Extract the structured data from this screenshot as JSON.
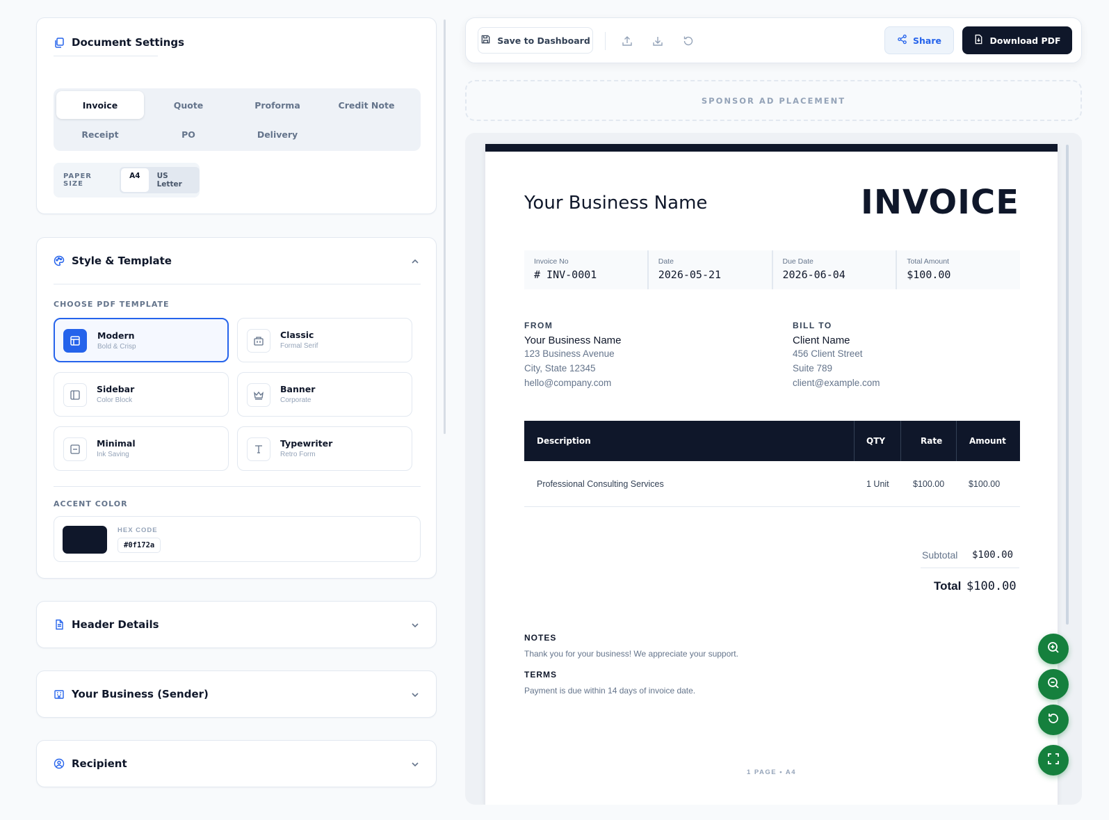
{
  "colors": {
    "accent": "#0f172a",
    "primary_blue": "#2563eb",
    "fab_green": "#15803d"
  },
  "document_settings": {
    "title": "Document Settings",
    "doc_types": [
      "Invoice",
      "Quote",
      "Proforma",
      "Credit Note",
      "Receipt",
      "PO",
      "Delivery"
    ],
    "selected_doc_type": "Invoice",
    "paper_size_label": "PAPER SIZE",
    "paper_sizes": [
      "A4",
      "US Letter"
    ],
    "selected_paper_size": "A4"
  },
  "style_template": {
    "title": "Style & Template",
    "choose_label": "CHOOSE PDF TEMPLATE",
    "templates": [
      {
        "name": "Modern",
        "sub": "Bold & Crisp",
        "icon": "layout-icon"
      },
      {
        "name": "Classic",
        "sub": "Formal Serif",
        "icon": "building-icon"
      },
      {
        "name": "Sidebar",
        "sub": "Color Block",
        "icon": "sidebar-icon"
      },
      {
        "name": "Banner",
        "sub": "Corporate",
        "icon": "crown-icon"
      },
      {
        "name": "Minimal",
        "sub": "Ink Saving",
        "icon": "minus-box-icon"
      },
      {
        "name": "Typewriter",
        "sub": "Retro Form",
        "icon": "type-icon"
      }
    ],
    "selected_template": "Modern",
    "accent_label": "ACCENT COLOR",
    "hex_label": "HEX CODE",
    "hex_value": "#0f172a"
  },
  "collapsed_sections": [
    {
      "title": "Header Details",
      "icon": "file-text-icon"
    },
    {
      "title": "Your Business (Sender)",
      "icon": "building-icon"
    },
    {
      "title": "Recipient",
      "icon": "user-circle-icon"
    }
  ],
  "toolbar": {
    "save_label": "Save to Dashboard",
    "share_label": "Share",
    "download_label": "Download PDF"
  },
  "ad": {
    "label": "SPONSOR AD PLACEMENT"
  },
  "invoice": {
    "business_name": "Your Business Name",
    "doc_title": "INVOICE",
    "meta": [
      {
        "label": "Invoice No",
        "value": "# INV-0001"
      },
      {
        "label": "Date",
        "value": "2026-05-21"
      },
      {
        "label": "Due Date",
        "value": "2026-06-04"
      },
      {
        "label": "Total Amount",
        "value": "$100.00"
      }
    ],
    "from": {
      "heading": "FROM",
      "name": "Your Business Name",
      "lines": [
        "123 Business Avenue",
        "City, State 12345",
        "hello@company.com"
      ]
    },
    "bill_to": {
      "heading": "BILL TO",
      "name": "Client Name",
      "lines": [
        "456 Client Street",
        "Suite 789",
        "client@example.com"
      ]
    },
    "table": {
      "headers": [
        "Description",
        "QTY",
        "Rate",
        "Amount"
      ],
      "rows": [
        {
          "description": "Professional Consulting Services",
          "qty": "1 Unit",
          "rate": "$100.00",
          "amount": "$100.00"
        }
      ]
    },
    "subtotal_label": "Subtotal",
    "subtotal_value": "$100.00",
    "total_label": "Total",
    "total_value": "$100.00",
    "notes_heading": "NOTES",
    "notes_text": "Thank you for your business! We appreciate your support.",
    "terms_heading": "TERMS",
    "terms_text": "Payment is due within 14 days of invoice date.",
    "page_footer": "1 PAGE • A4"
  }
}
